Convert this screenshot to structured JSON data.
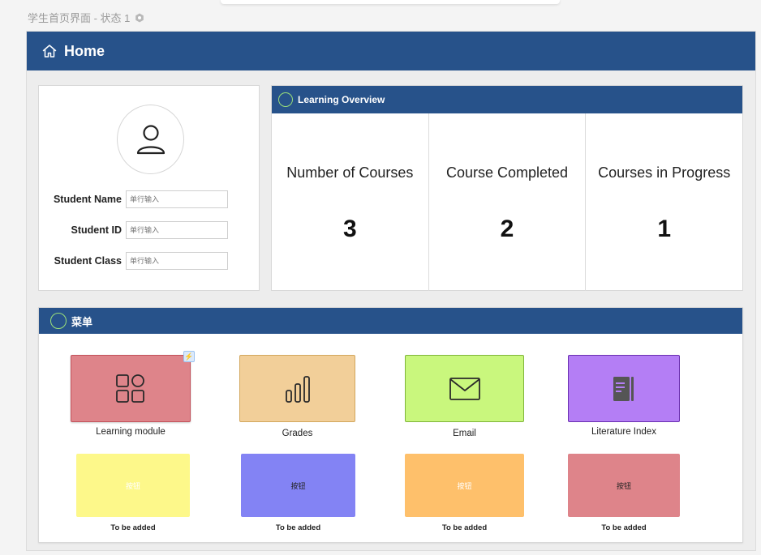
{
  "page": {
    "label": "学生首页界面 - 状态 1"
  },
  "header": {
    "title": "Home"
  },
  "profile": {
    "fields": [
      {
        "label": "Student Name",
        "placeholder": "单行输入"
      },
      {
        "label": "Student ID",
        "placeholder": "单行输入"
      },
      {
        "label": "Student Class",
        "placeholder": "单行输入"
      }
    ]
  },
  "overview": {
    "title": "Learning Overview",
    "stats": [
      {
        "label": "Number of Courses",
        "value": "3"
      },
      {
        "label": "Course Completed",
        "value": "2"
      },
      {
        "label": "Courses in Progress",
        "value": "1"
      }
    ]
  },
  "menu": {
    "title": "菜单",
    "tiles": [
      {
        "caption": "Learning module",
        "color": "#de848a",
        "icon": "grid-icon"
      },
      {
        "caption": "Grades",
        "color": "#f2cf99",
        "icon": "bar-chart-icon"
      },
      {
        "caption": "Email",
        "color": "#c9f77d",
        "icon": "mail-icon"
      },
      {
        "caption": "Literature Index",
        "color": "#b47ef5",
        "icon": "book-icon"
      }
    ],
    "placeholders": [
      {
        "label": "按钮",
        "caption": "To be added",
        "color": "#fdf88a"
      },
      {
        "label": "按钮",
        "caption": "To be added",
        "color": "#8383f4"
      },
      {
        "label": "按钮",
        "caption": "To be added",
        "color": "#fec06b"
      },
      {
        "label": "按钮",
        "caption": "To be added",
        "color": "#de848a"
      }
    ]
  },
  "colors": {
    "primary": "#27528a",
    "accent_ring": "#9be07a"
  }
}
